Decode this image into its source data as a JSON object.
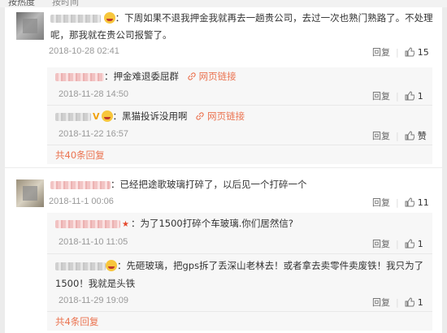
{
  "header": {
    "tab_hot": "按热度",
    "tab_time": "按时间"
  },
  "comments": [
    {
      "text": "下周如果不退我押金我就再去一趟贵公司，去过一次也熟门熟路了。不处理",
      "text_line2": "呢，那我就在贵公司报警了。",
      "time": "2018-10-28 02:41",
      "reply_label": "回复",
      "likes": "15",
      "replies": [
        {
          "text": "押金难退委屈群",
          "link_label": "网页链接",
          "time": "2018-11-28 14:50",
          "reply_label": "回复",
          "likes": "1"
        },
        {
          "text": "黑猫投诉没用啊",
          "link_label": "网页链接",
          "time": "2018-11-22 16:57",
          "reply_label": "回复",
          "likes": "赞"
        }
      ],
      "more_replies": "共40条回复"
    },
    {
      "text": "已经把途歌玻璃打碎了，以后见一个打碎一个",
      "time": "2018-11-1 00:06",
      "reply_label": "回复",
      "likes": "11",
      "replies": [
        {
          "text": "为了1500打碎个车玻璃.你们居然信?",
          "time": "2018-11-10 11:05",
          "reply_label": "回复",
          "likes": "1"
        },
        {
          "text": "先砸玻璃，把gps拆了丢深山老林去！或者拿去卖零件卖废铁！我只为了",
          "text_line2": "1500！我就是头铁",
          "time": "2018-11-29 19:09",
          "reply_label": "回复",
          "likes": "1"
        }
      ],
      "more_replies": "共4条回复"
    }
  ],
  "colors": {
    "accent": "#eb7350",
    "link": "#eb7350",
    "muted": "#999999"
  },
  "icons": {
    "like": "thumbs-up-icon",
    "link": "link-icon",
    "emoji": "laugh-emoji-icon"
  }
}
